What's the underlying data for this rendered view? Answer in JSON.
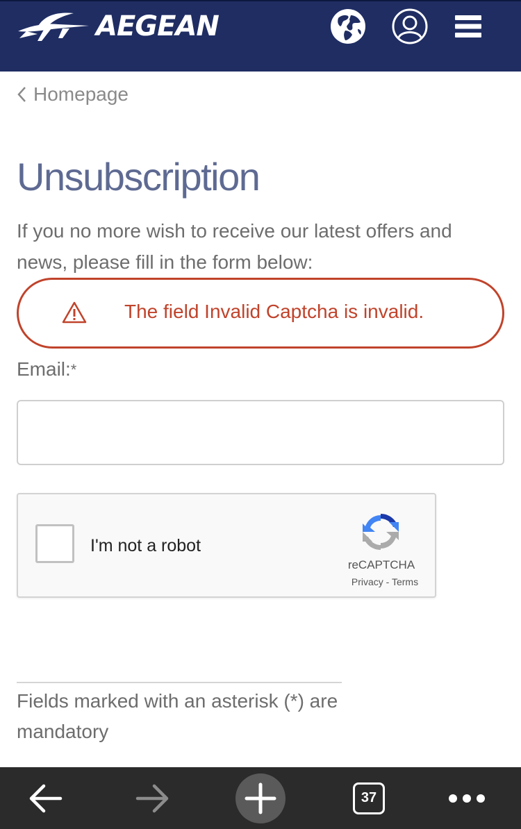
{
  "header": {
    "brand": "AEGEAN",
    "background": "#1f2d63",
    "icons": [
      "bird-logo-icon",
      "globe-icon",
      "user-icon",
      "menu-icon"
    ]
  },
  "breadcrumb": {
    "label": "Homepage"
  },
  "page": {
    "title": "Unsubscription",
    "intro": "If you no more wish to receive our latest offers and news, please fill in the form below:"
  },
  "error": {
    "message": "The field Invalid Captcha is invalid.",
    "color": "#c0432b"
  },
  "form": {
    "email_label": "Email:",
    "required_marker": "*",
    "email_value": ""
  },
  "recaptcha": {
    "label": "I'm not a robot",
    "brand": "reCAPTCHA",
    "privacy": "Privacy",
    "separator": " - ",
    "terms": "Terms",
    "checked": false
  },
  "footnote": {
    "text": "Fields marked with an asterisk (*) are mandatory"
  },
  "browser_bar": {
    "tab_count": "37",
    "icons": [
      "back-arrow-icon",
      "forward-arrow-icon",
      "new-tab-plus-icon",
      "tabs-icon",
      "more-dots-icon"
    ]
  }
}
